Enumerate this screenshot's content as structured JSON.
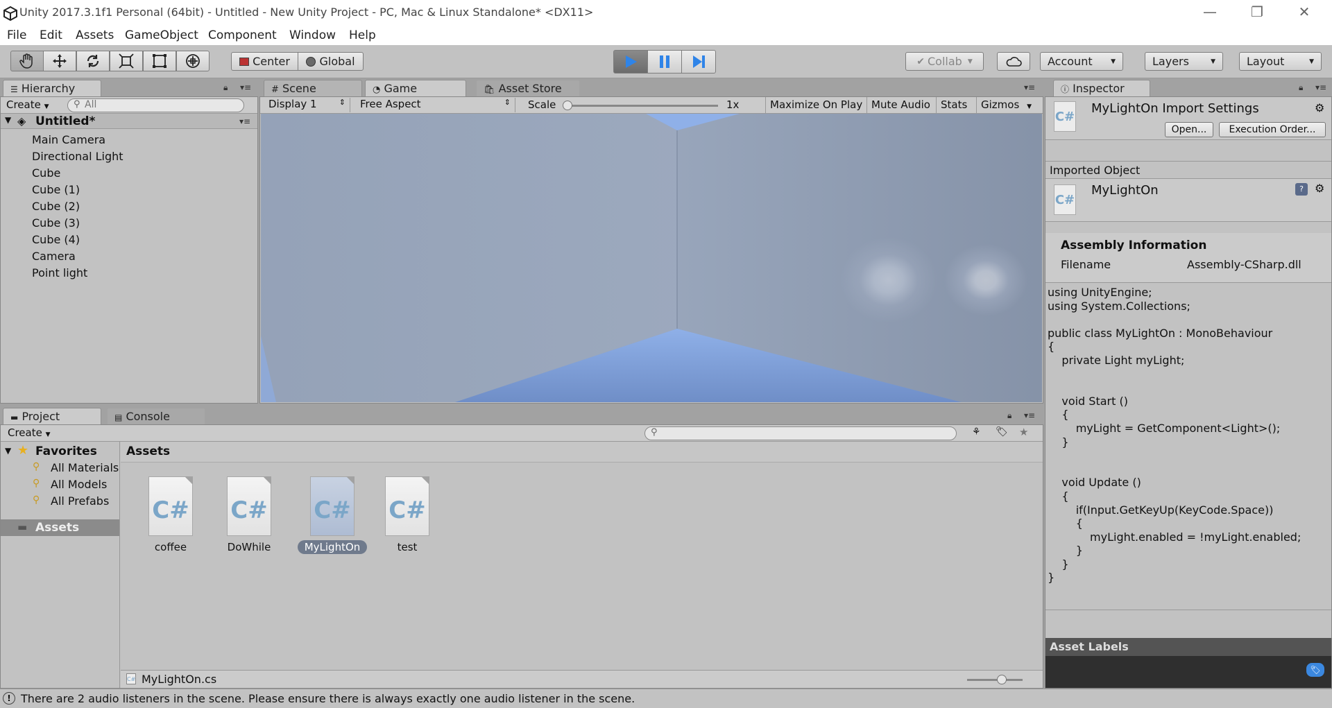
{
  "window": {
    "title": "Unity 2017.3.1f1 Personal (64bit) - Untitled - New Unity Project - PC, Mac & Linux Standalone* <DX11>",
    "controls": {
      "minimize": "—",
      "restore": "❐",
      "close": "✕"
    }
  },
  "menubar": [
    "File",
    "Edit",
    "Assets",
    "GameObject",
    "Component",
    "Window",
    "Help"
  ],
  "toolbar": {
    "pivot": "Center",
    "space": "Global",
    "collab": "Collab",
    "account": "Account",
    "layers": "Layers",
    "layout": "Layout"
  },
  "hierarchy": {
    "tab": "Hierarchy",
    "create": "Create",
    "search_placeholder": "All",
    "scene": "Untitled*",
    "items": [
      "Main Camera",
      "Directional Light",
      "Cube",
      "Cube (1)",
      "Cube (2)",
      "Cube (3)",
      "Cube (4)",
      "Camera",
      "Point light"
    ]
  },
  "center": {
    "tabs": [
      "Scene",
      "Game",
      "Asset Store"
    ],
    "active_tab": "Game",
    "display": "Display 1",
    "aspect": "Free Aspect",
    "scale_label": "Scale",
    "scale_value": "1x",
    "maximize": "Maximize On Play",
    "mute": "Mute Audio",
    "stats": "Stats",
    "gizmos": "Gizmos"
  },
  "project": {
    "tabs": [
      "Project",
      "Console"
    ],
    "create": "Create",
    "favorites": "Favorites",
    "favorite_items": [
      "All Materials",
      "All Models",
      "All Prefabs"
    ],
    "assets_folder": "Assets",
    "breadcrumb": "Assets",
    "assets": [
      {
        "name": "coffee",
        "selected": false
      },
      {
        "name": "DoWhile",
        "selected": false
      },
      {
        "name": "MyLightOn",
        "selected": true
      },
      {
        "name": "test",
        "selected": false
      }
    ],
    "selected_path": "MyLightOn.cs"
  },
  "inspector": {
    "tab": "Inspector",
    "title": "MyLightOn Import Settings",
    "open_button": "Open...",
    "exec_button": "Execution Order...",
    "imported_object": "Imported Object",
    "object_name": "MyLightOn",
    "assembly_header": "Assembly Information",
    "filename_label": "Filename",
    "filename_value": "Assembly-CSharp.dll",
    "code": "using UnityEngine;\nusing System.Collections;\n\npublic class MyLightOn : MonoBehaviour\n{\n    private Light myLight;\n\n\n    void Start ()\n    {\n        myLight = GetComponent<Light>();\n    }\n\n\n    void Update ()\n    {\n        if(Input.GetKeyUp(KeyCode.Space))\n        {\n            myLight.enabled = !myLight.enabled;\n        }\n    }\n}",
    "asset_labels": "Asset Labels"
  },
  "status": {
    "message": "There are 2 audio listeners in the scene. Please ensure there is always exactly one audio listener in the scene."
  },
  "icons": {
    "csharp_glyph": "C#"
  },
  "colors": {
    "play_active": "#2f84e8",
    "selection": "#6f7a8c"
  }
}
